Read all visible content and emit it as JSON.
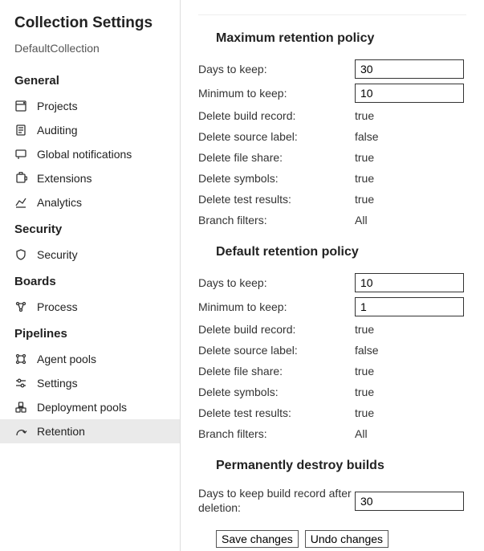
{
  "sidebar": {
    "title": "Collection Settings",
    "subtitle": "DefaultCollection",
    "groups": [
      {
        "title": "General",
        "items": [
          {
            "label": "Projects",
            "icon": "projects"
          },
          {
            "label": "Auditing",
            "icon": "auditing"
          },
          {
            "label": "Global notifications",
            "icon": "notifications"
          },
          {
            "label": "Extensions",
            "icon": "extensions"
          },
          {
            "label": "Analytics",
            "icon": "analytics"
          }
        ]
      },
      {
        "title": "Security",
        "items": [
          {
            "label": "Security",
            "icon": "shield"
          }
        ]
      },
      {
        "title": "Boards",
        "items": [
          {
            "label": "Process",
            "icon": "process"
          }
        ]
      },
      {
        "title": "Pipelines",
        "items": [
          {
            "label": "Agent pools",
            "icon": "agent-pools"
          },
          {
            "label": "Settings",
            "icon": "settings"
          },
          {
            "label": "Deployment pools",
            "icon": "deployment"
          },
          {
            "label": "Retention",
            "icon": "retention",
            "selected": true
          }
        ]
      }
    ]
  },
  "main": {
    "sections": {
      "max": {
        "title": "Maximum retention policy",
        "days_to_keep_label": "Days to keep:",
        "days_to_keep": "30",
        "min_to_keep_label": "Minimum to keep:",
        "min_to_keep": "10",
        "delete_build_record_label": "Delete build record:",
        "delete_build_record": "true",
        "delete_source_label_label": "Delete source label:",
        "delete_source_label": "false",
        "delete_file_share_label": "Delete file share:",
        "delete_file_share": "true",
        "delete_symbols_label": "Delete symbols:",
        "delete_symbols": "true",
        "delete_test_results_label": "Delete test results:",
        "delete_test_results": "true",
        "branch_filters_label": "Branch filters:",
        "branch_filters": "All"
      },
      "default": {
        "title": "Default retention policy",
        "days_to_keep_label": "Days to keep:",
        "days_to_keep": "10",
        "min_to_keep_label": "Minimum to keep:",
        "min_to_keep": "1",
        "delete_build_record_label": "Delete build record:",
        "delete_build_record": "true",
        "delete_source_label_label": "Delete source label:",
        "delete_source_label": "false",
        "delete_file_share_label": "Delete file share:",
        "delete_file_share": "true",
        "delete_symbols_label": "Delete symbols:",
        "delete_symbols": "true",
        "delete_test_results_label": "Delete test results:",
        "delete_test_results": "true",
        "branch_filters_label": "Branch filters:",
        "branch_filters": "All"
      },
      "destroy": {
        "title": "Permanently destroy builds",
        "days_label": "Days to keep build record after deletion:",
        "days": "30"
      }
    },
    "buttons": {
      "save": "Save changes",
      "undo": "Undo changes"
    }
  }
}
